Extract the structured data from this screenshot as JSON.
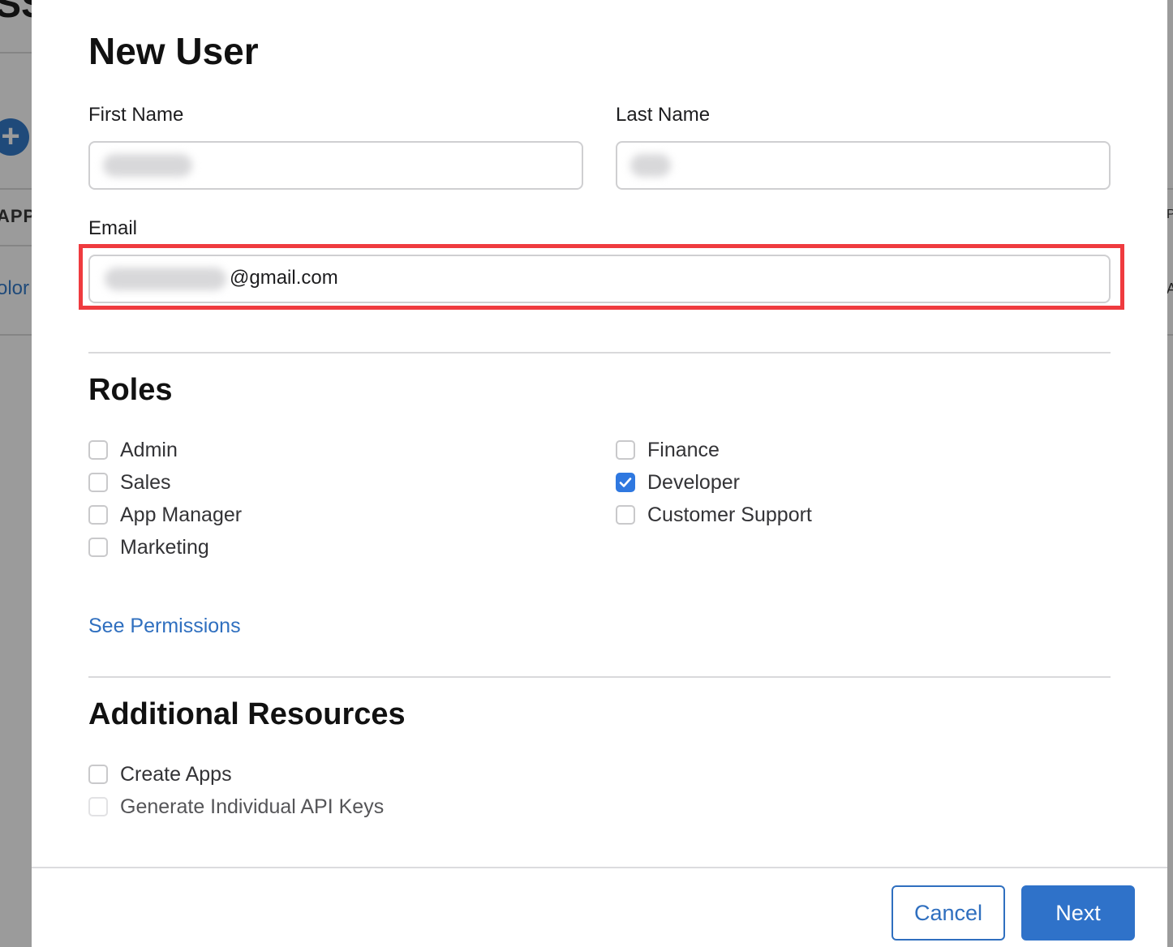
{
  "background": {
    "title_fragment": "SS",
    "column_fragment": "APPL",
    "link_fragment": "olor",
    "right_fragment_1": "P",
    "right_fragment_2": "A",
    "add_icon": "plus-circle-icon"
  },
  "modal": {
    "title": "New User",
    "fields": {
      "first_name_label": "First Name",
      "last_name_label": "Last Name",
      "email_label": "Email",
      "email_value_visible": "@gmail.com"
    },
    "roles": {
      "title": "Roles",
      "left": [
        {
          "label": "Admin",
          "checked": false
        },
        {
          "label": "Sales",
          "checked": false
        },
        {
          "label": "App Manager",
          "checked": false
        },
        {
          "label": "Marketing",
          "checked": false
        }
      ],
      "right": [
        {
          "label": "Finance",
          "checked": false
        },
        {
          "label": "Developer",
          "checked": true
        },
        {
          "label": "Customer Support",
          "checked": false
        }
      ],
      "permissions_link": "See Permissions"
    },
    "additional": {
      "title": "Additional Resources",
      "items": [
        {
          "label": "Create Apps",
          "checked": false,
          "disabled": false
        },
        {
          "label": "Generate Individual API Keys",
          "checked": false,
          "disabled": true
        }
      ]
    },
    "footer": {
      "cancel_label": "Cancel",
      "next_label": "Next"
    }
  },
  "colors": {
    "accent": "#2f72c9",
    "highlight": "#ef3b3f",
    "checked": "#2f78e0"
  }
}
